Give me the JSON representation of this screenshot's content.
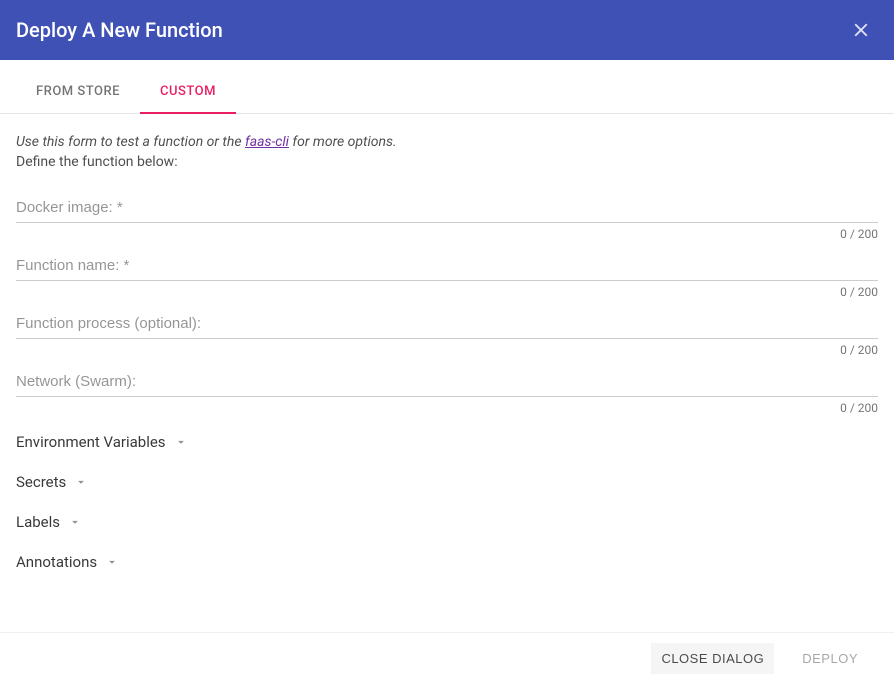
{
  "header": {
    "title": "Deploy A New Function"
  },
  "tabs": {
    "from_store": "FROM STORE",
    "custom": "CUSTOM"
  },
  "intro": {
    "line1_prefix": "Use this form to test a function or the ",
    "cli_link": "faas-cli",
    "line1_suffix": " for more options.",
    "line2": "Define the function below:"
  },
  "fields": {
    "docker_image": {
      "placeholder": "Docker image: *",
      "counter": "0 / 200"
    },
    "function_name": {
      "placeholder": "Function name: *",
      "counter": "0 / 200"
    },
    "function_process": {
      "placeholder": "Function process (optional):",
      "counter": "0 / 200"
    },
    "network": {
      "placeholder": "Network (Swarm):",
      "counter": "0 / 200"
    }
  },
  "expanders": {
    "env_vars": "Environment Variables",
    "secrets": "Secrets",
    "labels": "Labels",
    "annotations": "Annotations"
  },
  "footer": {
    "close_dialog": "CLOSE DIALOG",
    "deploy": "DEPLOY"
  }
}
